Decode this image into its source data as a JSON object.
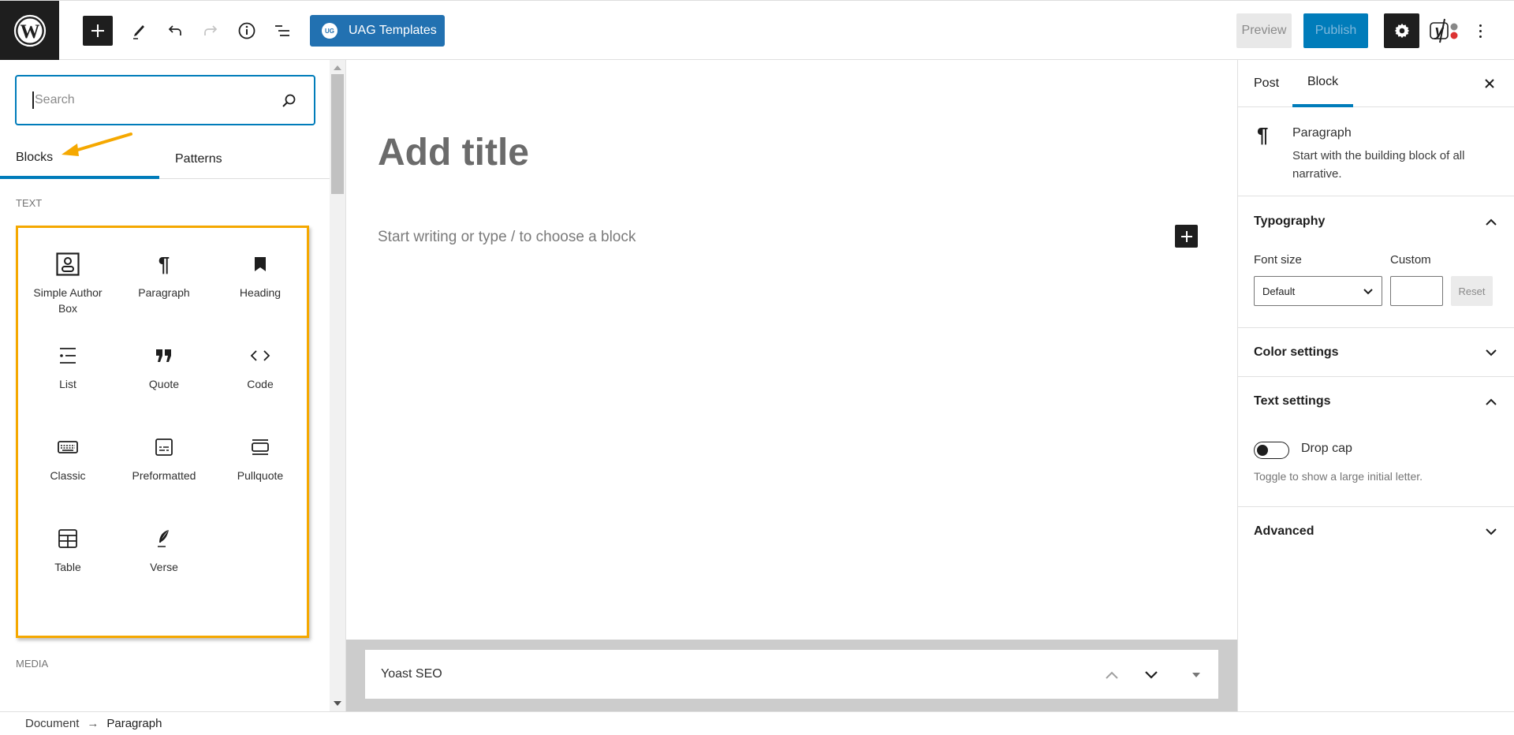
{
  "topbar": {
    "logo": "wordpress-logo",
    "tools": [
      {
        "name": "inserter-toggle",
        "icon": "plus-icon"
      },
      {
        "name": "tools",
        "icon": "pencil-icon"
      },
      {
        "name": "undo",
        "icon": "undo-icon"
      },
      {
        "name": "redo",
        "icon": "redo-icon",
        "disabled": true
      },
      {
        "name": "details",
        "icon": "info-icon"
      },
      {
        "name": "list-view",
        "icon": "list-view-icon"
      }
    ],
    "uag_badge": "UG",
    "uag_label": "UAG Templates",
    "preview_label": "Preview",
    "publish_label": "Publish",
    "settings_icon": "gear-icon",
    "yoast_icon": "yoast-icon",
    "more_icon": "more-vertical-icon",
    "colors": {
      "accent": "#007cba",
      "uag": "#2271b1",
      "dark": "#1e1e1e"
    }
  },
  "inserter": {
    "search": {
      "value": "",
      "placeholder": "Search"
    },
    "tabs": [
      {
        "label": "Blocks",
        "active": true
      },
      {
        "label": "Patterns",
        "active": false
      }
    ],
    "categories": [
      {
        "label": "TEXT",
        "blocks": [
          {
            "label": "Simple Author Box",
            "icon": "author-box-icon"
          },
          {
            "label": "Paragraph",
            "icon": "paragraph-icon"
          },
          {
            "label": "Heading",
            "icon": "heading-bookmark-icon"
          },
          {
            "label": "List",
            "icon": "list-icon"
          },
          {
            "label": "Quote",
            "icon": "quote-icon"
          },
          {
            "label": "Code",
            "icon": "code-icon"
          },
          {
            "label": "Classic",
            "icon": "keyboard-icon"
          },
          {
            "label": "Preformatted",
            "icon": "preformatted-icon"
          },
          {
            "label": "Pullquote",
            "icon": "pullquote-icon"
          },
          {
            "label": "Table",
            "icon": "table-icon"
          },
          {
            "label": "Verse",
            "icon": "verse-feather-icon"
          }
        ]
      },
      {
        "label": "MEDIA",
        "blocks": []
      }
    ],
    "highlight_color": "#f5a800"
  },
  "editor": {
    "title_placeholder": "Add title",
    "paragraph_placeholder": "Start writing or type / to choose a block",
    "metabox": {
      "title": "Yoast SEO"
    }
  },
  "sidebar": {
    "tabs": [
      {
        "label": "Post",
        "active": false
      },
      {
        "label": "Block",
        "active": true
      }
    ],
    "block_card": {
      "icon": "¶",
      "title": "Paragraph",
      "description": "Start with the building block of all narrative."
    },
    "panels": {
      "typography": {
        "title": "Typography",
        "open": true,
        "font_size_label": "Font size",
        "font_size_value": "Default",
        "custom_label": "Custom",
        "custom_value": "",
        "reset_label": "Reset"
      },
      "color": {
        "title": "Color settings",
        "open": false
      },
      "text": {
        "title": "Text settings",
        "open": true,
        "drop_cap_label": "Drop cap",
        "drop_cap_on": false,
        "help": "Toggle to show a large initial letter."
      },
      "advanced": {
        "title": "Advanced",
        "open": false
      }
    }
  },
  "footer": {
    "breadcrumb": [
      "Document",
      "Paragraph"
    ],
    "separator": "→"
  }
}
